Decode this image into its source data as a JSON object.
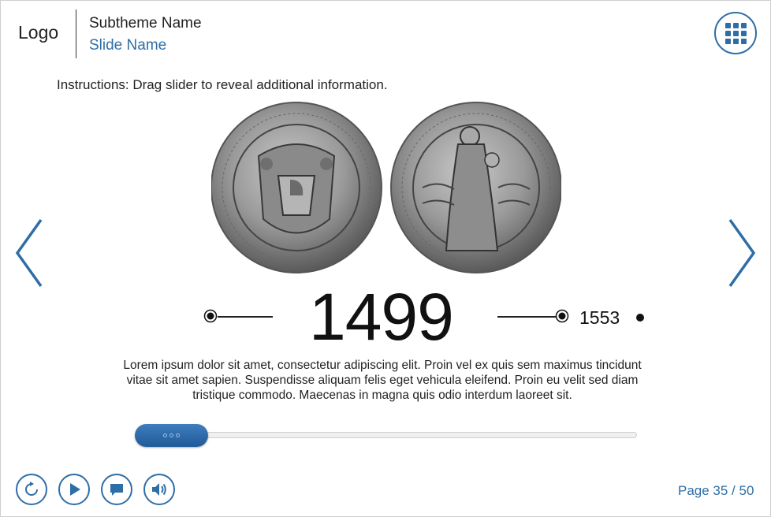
{
  "header": {
    "logo": "Logo",
    "subtheme": "Subtheme Name",
    "slide_name": "Slide Name",
    "menu_icon": "grid-menu-icon"
  },
  "instructions": "Instructions: Drag slider to reveal additional information.",
  "timeline": {
    "current_year": "1499",
    "next_year": "1553"
  },
  "body_text": "Lorem ipsum dolor sit amet, consectetur adipiscing elit. Proin vel ex quis sem maximus tincidunt vitae sit amet sapien. Suspendisse aliquam felis eget vehicula eleifend. Proin eu velit sed diam tristique commodo. Maecenas in magna quis odio interdum laoreet sit.",
  "slider": {
    "position": 0
  },
  "controls": {
    "replay_icon": "replay-icon",
    "play_icon": "play-icon",
    "captions_icon": "chat-icon",
    "audio_icon": "speaker-icon"
  },
  "page_indicator": "Page 35 / 50",
  "colors": {
    "accent": "#2e6ea6",
    "slider_handle": "#2a69a8",
    "text": "#222222"
  }
}
